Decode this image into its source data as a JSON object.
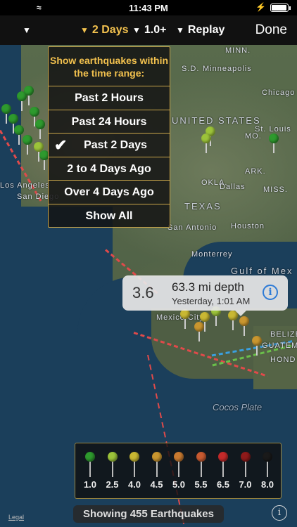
{
  "status_bar": {
    "time": "11:43 PM"
  },
  "toolbar": {
    "items": [
      {
        "label": "",
        "active": false
      },
      {
        "label": "2 Days",
        "active": true
      },
      {
        "label": "1.0+",
        "active": false
      },
      {
        "label": "Replay",
        "active": false
      }
    ],
    "done_label": "Done"
  },
  "dropdown": {
    "header": "Show earthquakes within the time range:",
    "options": [
      "Past 2 Hours",
      "Past 24 Hours",
      "Past 2 Days",
      "2 to 4 Days Ago",
      "Over 4 Days Ago",
      "Show All"
    ],
    "selected": "Past 2 Days"
  },
  "map_labels": {
    "minneapolis": "Minneapolis",
    "sd": "S.D.",
    "minn": "MINN.",
    "chicago": "Chicago",
    "united_states": "UNITED STATES",
    "st_louis": "St. Louis",
    "mo": "MO.",
    "okla": "OKLA.",
    "ark": "ARK.",
    "dallas": "Dallas",
    "miss": "MISS.",
    "los_angeles": "Los Angeles",
    "san_diego": "San Diego",
    "texas": "TEXAS",
    "san_antonio": "San Antonio",
    "houston": "Houston",
    "monterrey": "Monterrey",
    "gulf": "Gulf of Mex",
    "mexico_city": "Mexico City",
    "belize": "BELIZE",
    "guatemala": "GUATEMALA",
    "hond": "HOND",
    "cocos_plate": "Cocos Plate",
    "legal": "Legal"
  },
  "callout": {
    "magnitude": "3.6",
    "depth": "63.3 mi depth",
    "time": "Yesterday, 1:01 AM",
    "info_icon": "info-icon"
  },
  "legend": {
    "items": [
      {
        "label": "1.0",
        "color": "#2e9a2e"
      },
      {
        "label": "2.5",
        "color": "#9cc33a"
      },
      {
        "label": "4.0",
        "color": "#c9b832"
      },
      {
        "label": "4.5",
        "color": "#c9962f"
      },
      {
        "label": "5.0",
        "color": "#c87a30"
      },
      {
        "label": "5.5",
        "color": "#c85a30"
      },
      {
        "label": "6.5",
        "color": "#c42a2a"
      },
      {
        "label": "7.0",
        "color": "#8e1a1a"
      },
      {
        "label": "8.0",
        "color": "#1a1a1a"
      }
    ]
  },
  "footer": {
    "count_text": "Showing 455 Earthquakes"
  },
  "colors": {
    "accent": "#f2c14e",
    "border": "#caa64a",
    "info_blue": "#2e7bd6"
  }
}
